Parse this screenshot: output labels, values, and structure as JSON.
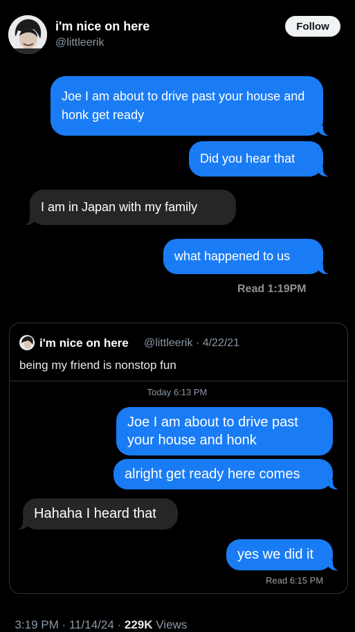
{
  "tweet": {
    "author_name": "i'm nice on here",
    "author_handle": "@littleerik",
    "follow_label": "Follow",
    "messages": [
      {
        "side": "right",
        "text": "Joe I am about to drive past your house and honk get ready"
      },
      {
        "side": "right",
        "text": "Did you hear that"
      },
      {
        "side": "left",
        "text": "I am in Japan with my family"
      },
      {
        "side": "right",
        "text": "what happened to us"
      }
    ],
    "read_label": "Read 1:19PM",
    "footer_time": "3:19 PM · 11/14/24 · ",
    "footer_views_count": "229K",
    "footer_views_label": " Views"
  },
  "quote": {
    "author_name": "i'm nice on here",
    "meta": "@littleerik · 4/22/21",
    "text": "being my friend is nonstop fun",
    "timestamp": "Today 6:13 PM",
    "messages": [
      {
        "side": "right",
        "text": "Joe I am about to drive past your house and honk"
      },
      {
        "side": "right",
        "text": "alright get ready here comes"
      },
      {
        "side": "left",
        "text": "Hahaha I heard that"
      },
      {
        "side": "right",
        "text": "yes we did it"
      }
    ],
    "read_label": "Read 6:15 PM"
  },
  "colors": {
    "bubble_blue": "#1a7cf5",
    "bubble_gray": "#262628",
    "background": "#000000"
  },
  "icons": [
    "avatar-photo",
    "quote-avatar-photo"
  ]
}
